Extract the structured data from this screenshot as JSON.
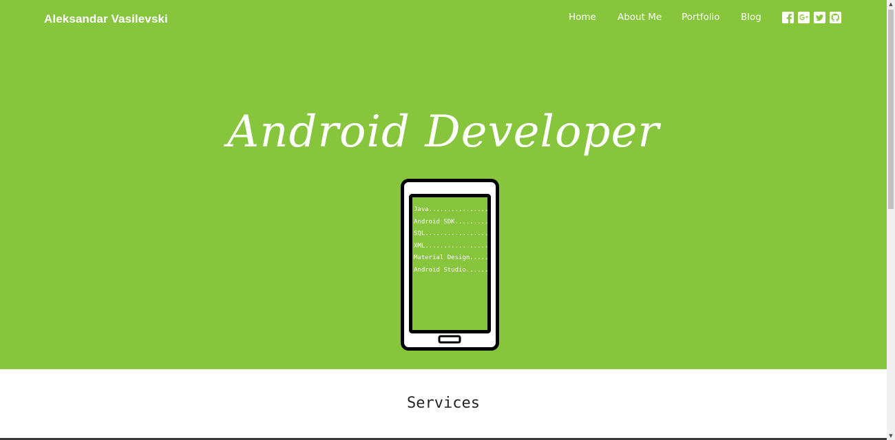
{
  "brand": {
    "name": "Aleksandar Vasilevski"
  },
  "nav": {
    "items": [
      {
        "label": "Home"
      },
      {
        "label": "About Me"
      },
      {
        "label": "Portfolio"
      },
      {
        "label": "Blog"
      }
    ],
    "social": [
      {
        "icon": "facebook-icon"
      },
      {
        "icon": "google-plus-icon"
      },
      {
        "icon": "twitter-icon"
      },
      {
        "icon": "github-icon"
      }
    ]
  },
  "hero": {
    "title": "Android Developer",
    "background": "#86c53c",
    "skills": [
      "Java................",
      "Android SDK.........",
      "SQL.................",
      "XML.................",
      "Material Design.....",
      "Android Studio......"
    ]
  },
  "services": {
    "title": "Services"
  }
}
